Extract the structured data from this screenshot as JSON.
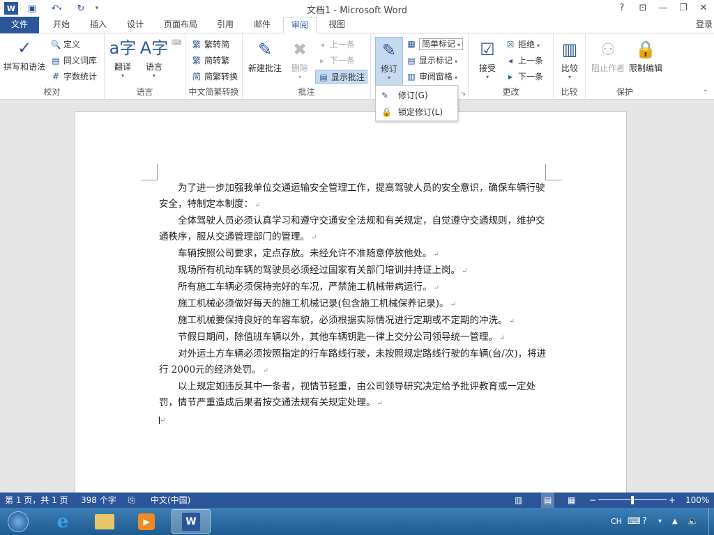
{
  "window": {
    "title": "文档1 - Microsoft Word",
    "help": "?",
    "signin": "登录"
  },
  "tabs": [
    "文件",
    "开始",
    "插入",
    "设计",
    "页面布局",
    "引用",
    "邮件",
    "审阅",
    "视图"
  ],
  "groups": {
    "proofing": {
      "label": "校对",
      "spelling": "拼写和语法",
      "define": "定义",
      "thesaurus": "同义词库",
      "wordcount": "字数统计"
    },
    "language": {
      "label": "语言",
      "translate": "翻译",
      "language": "语言"
    },
    "chinese": {
      "label": "中文简繁转换",
      "to_simplified": "繁转简",
      "to_traditional": "简转繁",
      "convert": "简繁转换"
    },
    "comments": {
      "label": "批注",
      "new": "新建批注",
      "delete": "删除",
      "prev": "上一条",
      "next": "下一条",
      "show": "显示批注"
    },
    "tracking": {
      "track": "修订",
      "markup": "简单标记",
      "show_markup": "显示标记",
      "pane": "审阅窗格"
    },
    "changes": {
      "label": "更改",
      "accept": "接受",
      "reject": "拒绝",
      "prev": "上一条",
      "next": "下一条"
    },
    "compare": {
      "label": "比较",
      "compare": "比较"
    },
    "protect": {
      "label": "保护",
      "block": "阻止作者",
      "restrict": "限制编辑"
    }
  },
  "menu": {
    "item1": "修订(G)",
    "item2": "锁定修订(L)"
  },
  "doc": {
    "paragraphs": [
      "为了进一步加强我单位交通运输安全管理工作，提高驾驶人员的安全意识，确保车辆行驶安全，特制定本制度：",
      "全体驾驶人员必须认真学习和遵守交通安全法规和有关规定，自觉遵守交通规则，维护交通秩序，服从交通管理部门的管理。",
      "车辆按照公司要求，定点存放。未经允许不准随意停放他处。",
      "现场所有机动车辆的驾驶员必须经过国家有关部门培训并持证上岗。",
      "所有施工车辆必须保持完好的车况，严禁施工机械带病运行。",
      "施工机械必须做好每天的施工机械记录(包含施工机械保养记录)。",
      "施工机械要保持良好的车容车貌，必须根据实际情况进行定期或不定期的冲洗。",
      "节假日期间，除值班车辆以外，其他车辆钥匙一律上交分公司领导统一管理。",
      "对外运土方车辆必须按照指定的行车路线行驶，未按照规定路线行驶的车辆(台/次)，将进行 2000元的经济处罚。",
      "以上规定如违反其中一条者，视情节轻重，由公司领导研究决定给予批评教育或一定处罚，情节严重造成后果者按交通法规有关规定处理。"
    ]
  },
  "status": {
    "page": "第 1 页，共 1 页",
    "words": "398 个字",
    "lang": "中文(中国)",
    "zoom": "100%",
    "zoom_level": 1.0
  },
  "tray": {
    "lang": "CH"
  }
}
